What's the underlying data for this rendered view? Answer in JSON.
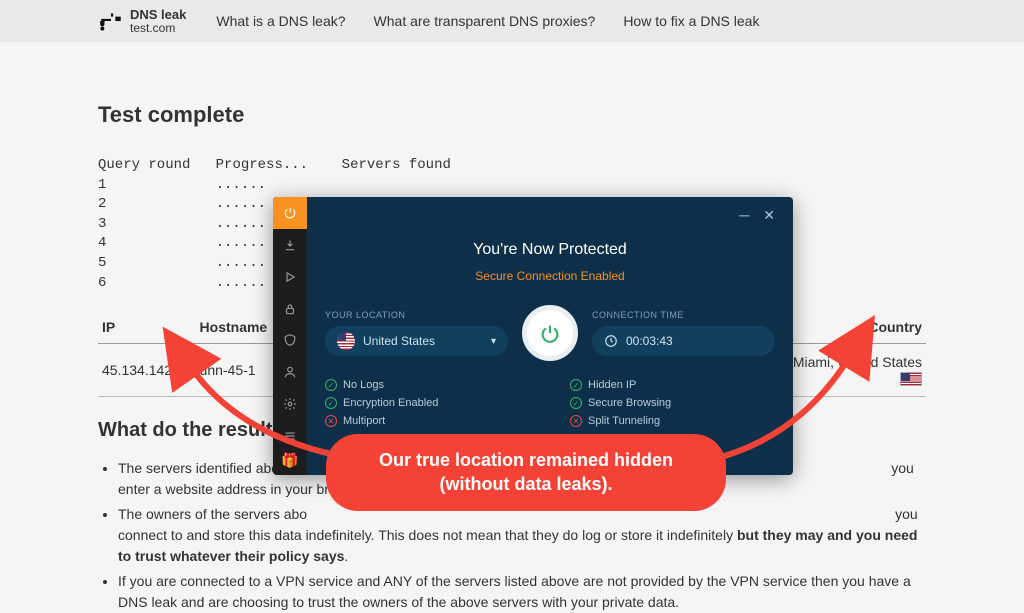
{
  "logo": {
    "line1": "DNS leak",
    "line2": "test.com"
  },
  "nav": [
    "What is a DNS leak?",
    "What are transparent DNS proxies?",
    "How to fix a DNS leak"
  ],
  "title": "Test complete",
  "progress": {
    "headers": [
      "Query round",
      "Progress...",
      "Servers found"
    ],
    "rows": [
      "1",
      "2",
      "3",
      "4",
      "5",
      "6"
    ],
    "dots": "......"
  },
  "table": {
    "headers": {
      "ip": "IP",
      "hostname": "Hostname",
      "country": "Country"
    },
    "row": {
      "ip": "45.134.142.65",
      "hostname": "unn-45-1",
      "country": "Miami, United States"
    }
  },
  "results_heading": "What do the results mean?",
  "bullets": [
    {
      "pre": "The servers identified above re",
      "mid": "",
      "post": "you enter a website address in your browser."
    },
    {
      "pre": "The owners of the servers abo",
      "mid": "",
      "post": "you connect to and store this data indefinitely. This does not mean that they do log or store it indefinitely ",
      "bold": "but they may and you need to trust whatever their policy says",
      "tail": "."
    },
    {
      "pre": "If you are connected to a VPN service and ANY of the servers listed above are not provided by the VPN service then you have a DNS leak and are choosing to trust the owners of the above servers with your private data.",
      "mid": "",
      "post": ""
    }
  ],
  "vpn": {
    "protected": "You're Now Protected",
    "secure": "Secure Connection Enabled",
    "location_label": "YOUR LOCATION",
    "location_value": "United States",
    "time_label": "CONNECTION TIME",
    "time_value": "00:03:43",
    "features_left": [
      "No Logs",
      "Encryption Enabled",
      "Multiport"
    ],
    "features_right": [
      "Hidden IP",
      "Secure Browsing",
      "Split Tunneling"
    ]
  },
  "annotation": "Our true location remained hidden (without data leaks)."
}
